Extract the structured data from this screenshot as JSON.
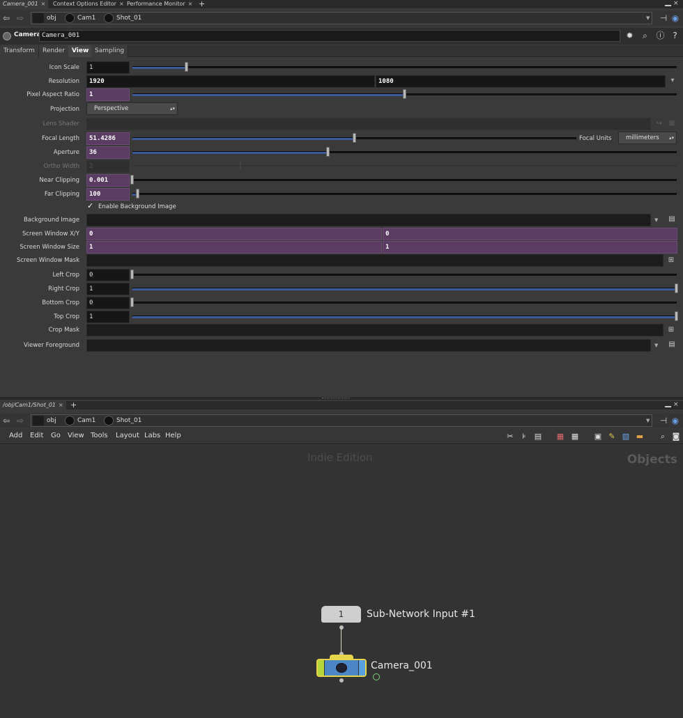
{
  "top_tabs": {
    "tab1": "Camera_001",
    "tab2": "Context Options Editor",
    "tab3": "Performance Monitor",
    "add": "+"
  },
  "path": {
    "obj": "obj",
    "cam1": "Cam1",
    "shot": "Shot_01"
  },
  "parm_header": {
    "type": "Camera",
    "name": "Camera_001"
  },
  "parm_tabs": [
    "Transform",
    "Render",
    "View",
    "Sampling"
  ],
  "parms": {
    "icon_scale": {
      "label": "Icon Scale",
      "value": "1",
      "slider": 0.1
    },
    "resolution": {
      "label": "Resolution",
      "x": "1920",
      "y": "1080"
    },
    "pixel_aspect": {
      "label": "Pixel Aspect Ratio",
      "value": "1",
      "slider": 0.5
    },
    "projection": {
      "label": "Projection",
      "value": "Perspective"
    },
    "lens_shader": {
      "label": "Lens Shader"
    },
    "focal_length": {
      "label": "Focal Length",
      "value": "51.4286",
      "slider": 0.5
    },
    "focal_units": {
      "label": "Focal Units",
      "value": "millimeters"
    },
    "aperture": {
      "label": "Aperture",
      "value": "36",
      "slider": 0.36
    },
    "ortho_width": {
      "label": "Ortho Width",
      "value": "2"
    },
    "near_clipping": {
      "label": "Near Clipping",
      "value": "0.001",
      "slider": 0
    },
    "far_clipping": {
      "label": "Far Clipping",
      "value": "100",
      "slider": 0.01
    },
    "enable_bg": {
      "label": "Enable Background Image",
      "checked": true
    },
    "background_image": {
      "label": "Background Image"
    },
    "screen_window_xy": {
      "label": "Screen Window X/Y",
      "x": "0",
      "y": "0"
    },
    "screen_window_size": {
      "label": "Screen Window Size",
      "x": "1",
      "y": "1"
    },
    "screen_window_mask": {
      "label": "Screen Window Mask"
    },
    "left_crop": {
      "label": "Left Crop",
      "value": "0",
      "slider": 0
    },
    "right_crop": {
      "label": "Right Crop",
      "value": "1",
      "slider": 1
    },
    "bottom_crop": {
      "label": "Bottom Crop",
      "value": "0",
      "slider": 0
    },
    "top_crop": {
      "label": "Top Crop",
      "value": "1",
      "slider": 1
    },
    "crop_mask": {
      "label": "Crop Mask"
    },
    "viewer_foreground": {
      "label": "Viewer Foreground"
    }
  },
  "net_tabs": {
    "tab1": "/obj/Cam1/Shot_01",
    "add": "+"
  },
  "net_menu": [
    "Add",
    "Edit",
    "Go",
    "View",
    "Tools",
    "Layout",
    "Labs",
    "Help"
  ],
  "network": {
    "watermark": "Indie Edition",
    "context": "Objects",
    "subnet_input_number": "1",
    "subnet_input_label": "Sub-Network Input #1",
    "camera_node_label": "Camera_001"
  }
}
